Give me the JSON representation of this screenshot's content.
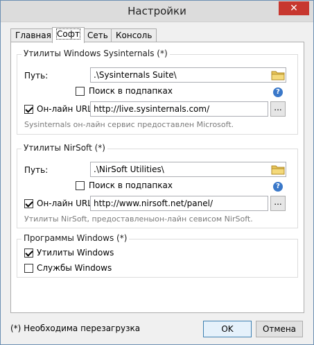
{
  "window": {
    "title": "Настройки",
    "close_glyph": "✕"
  },
  "tabs": [
    {
      "label": "Главная",
      "active": false
    },
    {
      "label": "Софт",
      "active": true
    },
    {
      "label": "Сеть",
      "active": false
    },
    {
      "label": "Консоль",
      "active": false
    }
  ],
  "sysinternals": {
    "title": "Утилиты Windows Sysinternals (*)",
    "path_label": "Путь:",
    "path_value": ".\\Sysinternals Suite\\",
    "subfolders_label": "Поиск в подпапках",
    "subfolders_checked": false,
    "online_label": "Он-лайн URL:",
    "online_checked": true,
    "online_url": "http://live.sysinternals.com/",
    "browse_label": "...",
    "note": "Sysinternals он-лайн сервис предоставлен Microsoft."
  },
  "nirsoft": {
    "title": "Утилиты NirSoft (*)",
    "path_label": "Путь:",
    "path_value": ".\\NirSoft Utilities\\",
    "subfolders_label": "Поиск в подпапках",
    "subfolders_checked": false,
    "online_label": "Он-лайн URL:",
    "online_checked": true,
    "online_url": "http://www.nirsoft.net/panel/",
    "browse_label": "...",
    "note": "Утилиты NirSoft, предоставленыон-лайн севисом NirSoft."
  },
  "windows_programs": {
    "title": "Программы Windows (*)",
    "utilities_label": "Утилиты Windows",
    "utilities_checked": true,
    "services_label": "Службы Windows",
    "services_checked": false
  },
  "footer": {
    "restart_note": "(*) Необходима перезагрузка",
    "ok_label": "OK",
    "cancel_label": "Отмена"
  },
  "colors": {
    "close_button": "#c7372f",
    "help_icon": "#3a78c9",
    "folder_icon": "#e8c55a"
  },
  "icons": {
    "help_glyph": "?"
  }
}
